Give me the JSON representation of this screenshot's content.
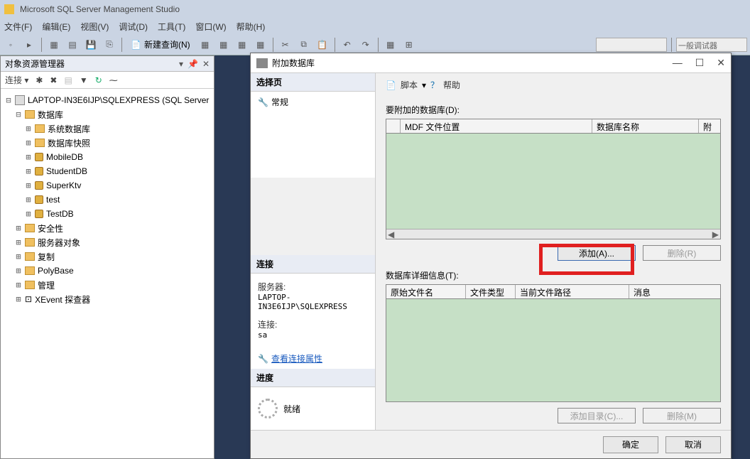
{
  "app": {
    "title": "Microsoft SQL Server Management Studio"
  },
  "menu": {
    "file": "文件(F)",
    "edit": "编辑(E)",
    "view": "视图(V)",
    "debug": "调试(D)",
    "tools": "工具(T)",
    "window": "窗口(W)",
    "help": "帮助(H)"
  },
  "toolbar": {
    "newquery": "新建查询(N)",
    "debuggerCombo": "一般调试器"
  },
  "objectExplorer": {
    "title": "对象资源管理器",
    "connectLabel": "连接 ▾",
    "server": "LAPTOP-IN3E6IJP\\SQLEXPRESS (SQL Server",
    "nodes": {
      "databases": "数据库",
      "sysdb": "系统数据库",
      "snapshot": "数据库快照",
      "db1": "MobileDB",
      "db2": "StudentDB",
      "db3": "SuperKtv",
      "db4": "test",
      "db5": "TestDB",
      "security": "安全性",
      "serverobj": "服务器对象",
      "replication": "复制",
      "polybase": "PolyBase",
      "mgmt": "管理",
      "xevent": "XEvent 探查器"
    }
  },
  "dialog": {
    "title": "附加数据库",
    "left": {
      "selectPage": "选择页",
      "general": "常规",
      "connection": "连接",
      "serverLabel": "服务器:",
      "serverVal": "LAPTOP-IN3E6IJP\\SQLEXPRESS",
      "connLabel": "连接:",
      "connVal": "sa",
      "viewProps": "查看连接属性",
      "progress": "进度",
      "ready": "就绪"
    },
    "right": {
      "script": "脚本",
      "help": "帮助",
      "attachLabel": "要附加的数据库(D):",
      "col_mdf": "MDF 文件位置",
      "col_dbname": "数据库名称",
      "col_att": "附",
      "addBtn": "添加(A)...",
      "removeBtn": "删除(R)",
      "detailLabel": "数据库详细信息(T):",
      "col_orig": "原始文件名",
      "col_type": "文件类型",
      "col_path": "当前文件路径",
      "col_msg": "消息",
      "addDir": "添加目录(C)...",
      "removeM": "删除(M)"
    },
    "footer": {
      "ok": "确定",
      "cancel": "取消"
    }
  }
}
